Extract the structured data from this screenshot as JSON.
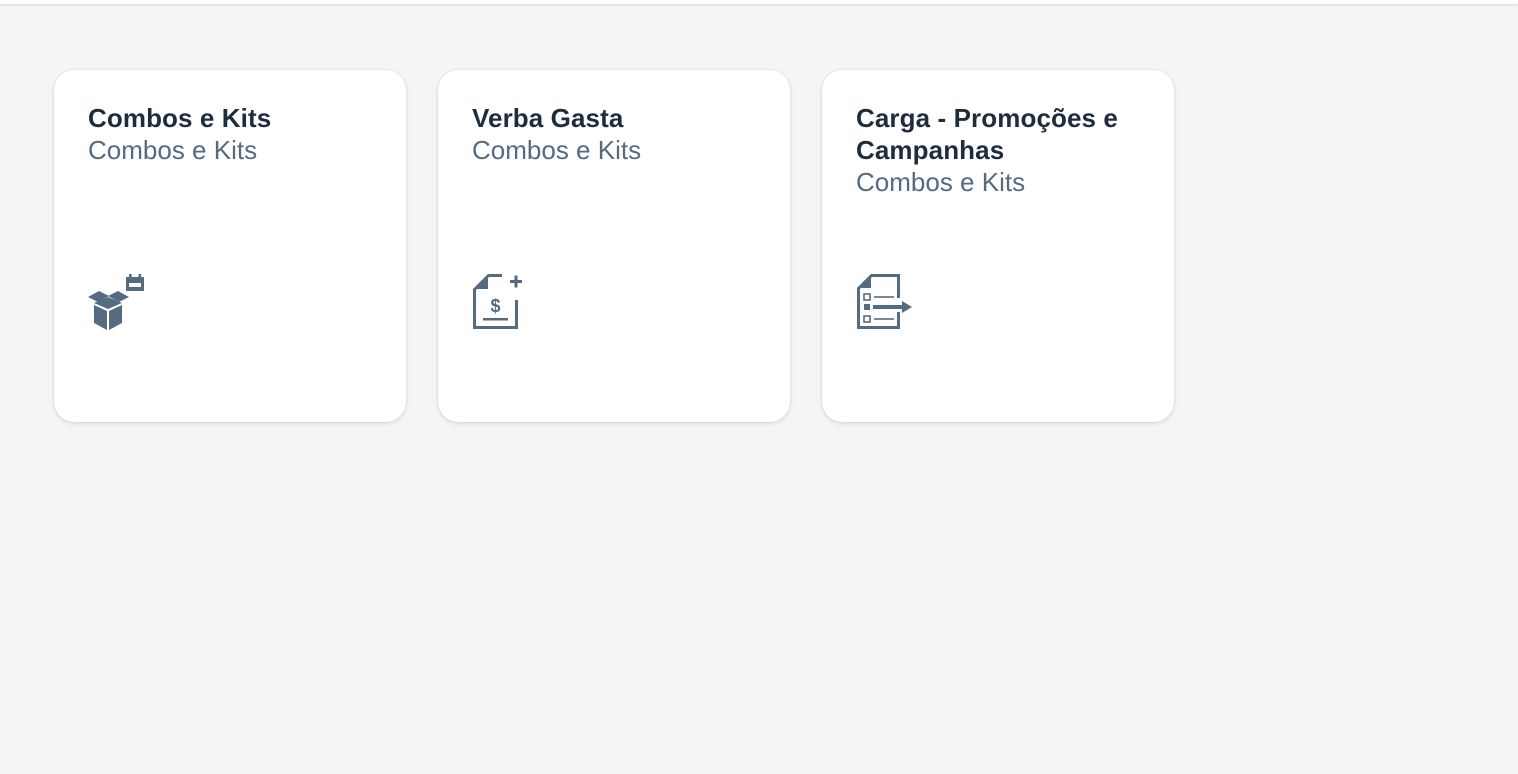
{
  "tiles": [
    {
      "title": "Combos e Kits",
      "subtitle": "Combos e Kits",
      "icon": "box-calendar-icon"
    },
    {
      "title": "Verba Gasta",
      "subtitle": "Combos e Kits",
      "icon": "dollar-document-add-icon"
    },
    {
      "title": "Carga - Promoções e Campanhas",
      "subtitle": "Combos e Kits",
      "icon": "list-document-export-icon"
    }
  ],
  "colors": {
    "background": "#f4f5f7",
    "tile": "#ffffff",
    "title": "#1d2d3e",
    "subtitle": "#556b82",
    "icon": "#556b82"
  }
}
